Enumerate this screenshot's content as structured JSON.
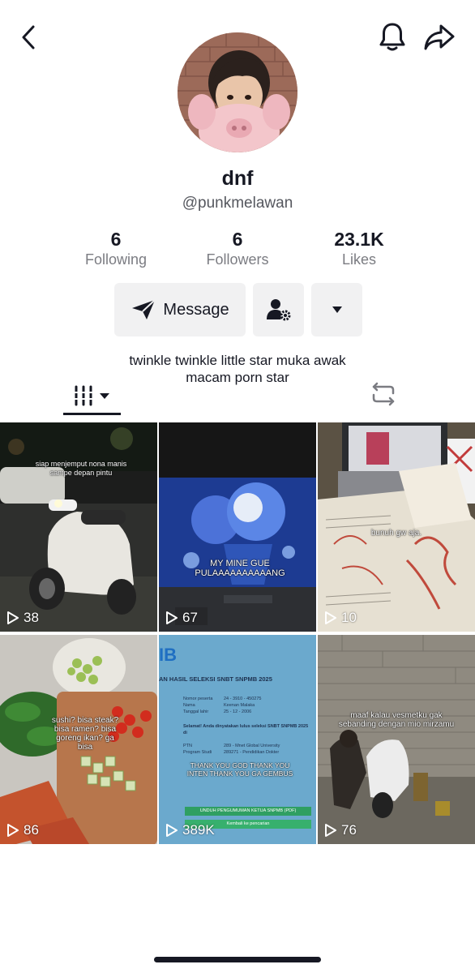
{
  "header": {
    "back_icon": "chevron-left-icon",
    "notification_icon": "bell-icon",
    "share_icon": "share-arrow-icon"
  },
  "profile": {
    "display_name": "dnf",
    "username": "@punkmelawan",
    "bio_line1": "twinkle twinkle little star muka awak",
    "bio_line2": "macam porn star"
  },
  "stats": {
    "following_value": "6",
    "following_label": "Following",
    "followers_value": "6",
    "followers_label": "Followers",
    "likes_value": "23.1K",
    "likes_label": "Likes"
  },
  "actions": {
    "message_label": "Message",
    "message_icon": "send-icon",
    "follow_settings_icon": "person-gear-icon",
    "more_icon": "caret-down-icon"
  },
  "tabs": {
    "videos_icon": "grid-columns-icon",
    "reposts_icon": "repost-icon"
  },
  "videos": [
    {
      "caption": "siap menjemput nona manis sampe depan pintu",
      "views": "38"
    },
    {
      "caption": "MY MINE GUE PULAAAAAAAAAANG",
      "views": "67"
    },
    {
      "caption": "bunuh gw aja.",
      "views": "10"
    },
    {
      "caption": "sushi? bisa steak? bisa ramen? bisa goreng ikan? ga bisa",
      "views": "86"
    },
    {
      "header": "IB",
      "doc_title": "AN HASIL SELEKSI SNBT SNPMB 2025",
      "f1_label": "Nomor peserta",
      "f1_value": "24 - 3910 - 450275",
      "f2_label": "Nama",
      "f2_value": "Keenan Malaka",
      "f3_label": "Tanggal lahir",
      "f3_value": "25 - 12 - 2006",
      "congrats": "Selamat! Anda dinyatakan lulus seleksi SNBT SNPMB 2025 di",
      "ptn_label": "PTN",
      "ptn_value": "289 - Mnet Global University",
      "prodi_label": "Program Studi",
      "prodi_value": "289271 - Pendidikan Dokter",
      "caption": "THANK YOU GOD THANK YOU INTEN THANK YOU GA GEMBUS",
      "btn1": "UNDUH PENGUMUMAN KETUA SNPMB (PDF)",
      "btn2": "Kembali ke pencarian",
      "views": "389K"
    },
    {
      "caption": "maaf kalau vesmetku gak sebanding dengan mio mirzamu",
      "views": "76"
    }
  ],
  "colors": {
    "text": "#161823",
    "secondary": "#7b7c82",
    "button_bg": "#f1f1f2"
  }
}
